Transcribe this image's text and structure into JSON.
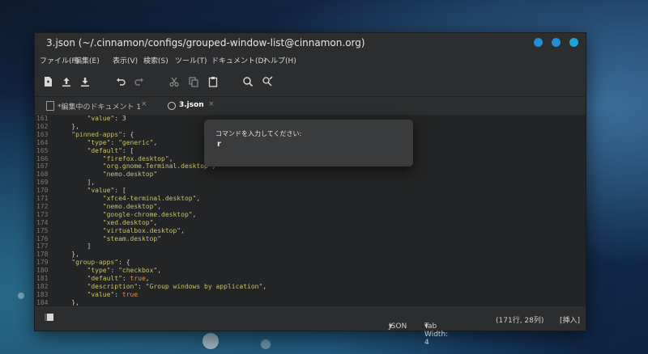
{
  "window": {
    "title": "3.json (~/.cinnamon/configs/grouped-window-list@cinnamon.org)",
    "controls": {
      "accent_color": "#1e8fd8"
    }
  },
  "menubar": {
    "items": [
      "ファイル(F)",
      "編集(E)",
      "表示(V)",
      "検索(S)",
      "ツール(T)",
      "ドキュメント(D)",
      "ヘルプ(H)"
    ]
  },
  "toolbar": {
    "buttons": [
      "new-document-icon",
      "save-upload-icon",
      "save-download-icon",
      "undo-icon",
      "redo-icon",
      "cut-icon",
      "copy-icon",
      "paste-icon",
      "search-icon",
      "replace-icon"
    ]
  },
  "tabs": [
    {
      "label": "*編集中のドキュメント 1",
      "close": "×",
      "active": false
    },
    {
      "label": "3.json",
      "close": "×",
      "active": true
    }
  ],
  "editor": {
    "lines": [
      {
        "n": "161",
        "text": "        \"value\": 3"
      },
      {
        "n": "162",
        "text": "    },"
      },
      {
        "n": "163",
        "text": "    \"pinned-apps\": {"
      },
      {
        "n": "164",
        "text": "        \"type\": \"generic\","
      },
      {
        "n": "165",
        "text": "        \"default\": ["
      },
      {
        "n": "166",
        "text": "            \"firefox.desktop\","
      },
      {
        "n": "167",
        "text": "            \"org.gnome.Terminal.desktop\","
      },
      {
        "n": "168",
        "text": "            \"nemo.desktop\""
      },
      {
        "n": "169",
        "text": "        ],"
      },
      {
        "n": "170",
        "text": "        \"value\": ["
      },
      {
        "n": "171",
        "text": "            \"xfce4-terminal.desktop\","
      },
      {
        "n": "172",
        "text": "            \"nemo.desktop\","
      },
      {
        "n": "173",
        "text": "            \"google-chrome.desktop\","
      },
      {
        "n": "174",
        "text": "            \"xed.desktop\","
      },
      {
        "n": "175",
        "text": "            \"virtualbox.desktop\","
      },
      {
        "n": "176",
        "text": "            \"steam.desktop\""
      },
      {
        "n": "177",
        "text": "        ]"
      },
      {
        "n": "178",
        "text": "    },"
      },
      {
        "n": "179",
        "text": "    \"group-apps\": {"
      },
      {
        "n": "180",
        "text": "        \"type\": \"checkbox\","
      },
      {
        "n": "181",
        "text": "        \"default\": true,"
      },
      {
        "n": "182",
        "text": "        \"description\": \"Group windows by application\","
      },
      {
        "n": "183",
        "text": "        \"value\": true"
      },
      {
        "n": "184",
        "text": "    },"
      }
    ]
  },
  "statusbar": {
    "language": "JSON",
    "tab_width": "Tab Width: 4",
    "position": "(171行, 28列)",
    "mode": "[挿入]"
  },
  "dialog": {
    "prompt": "コマンドを入力してください:",
    "value": "r"
  },
  "colors": {
    "string": "#c9c26a",
    "keyword": "#e08b44",
    "tab_underline": "#4aa3df"
  }
}
